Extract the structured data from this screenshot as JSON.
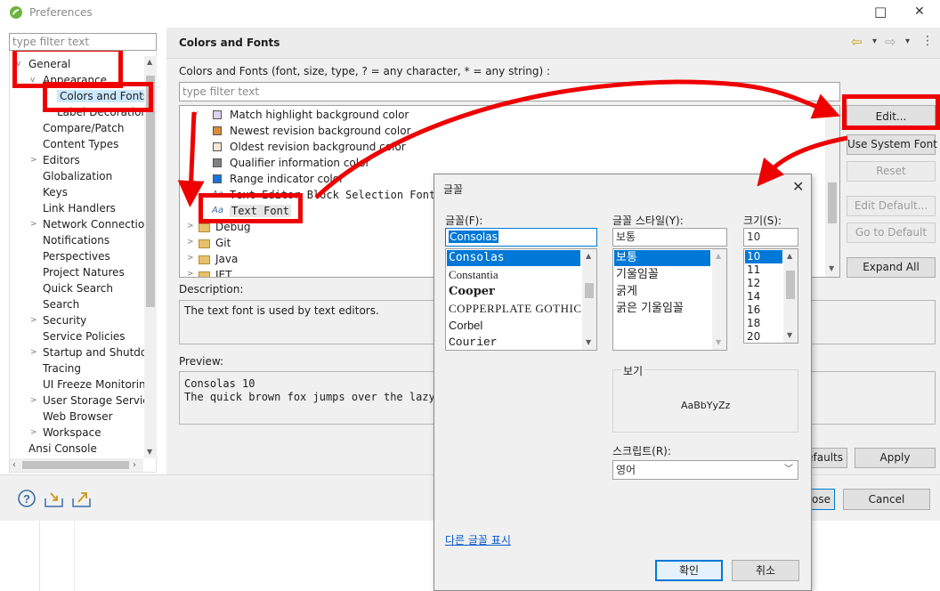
{
  "window": {
    "title": "Preferences",
    "controls": [
      "□",
      "✕"
    ]
  },
  "filter": {
    "placeholder": "type filter text"
  },
  "tree": {
    "items": [
      {
        "label": "General",
        "twisty": "v"
      },
      {
        "label": "Appearance",
        "twisty": "v"
      },
      {
        "label": "Colors and Fonts",
        "twisty": ""
      },
      {
        "label": "Label Decorations",
        "twisty": ""
      },
      {
        "label": "Compare/Patch",
        "twisty": ""
      },
      {
        "label": "Content Types",
        "twisty": ""
      },
      {
        "label": "Editors",
        "twisty": ">"
      },
      {
        "label": "Globalization",
        "twisty": ""
      },
      {
        "label": "Keys",
        "twisty": ""
      },
      {
        "label": "Link Handlers",
        "twisty": ""
      },
      {
        "label": "Network Connection",
        "twisty": ">"
      },
      {
        "label": "Notifications",
        "twisty": ""
      },
      {
        "label": "Perspectives",
        "twisty": ""
      },
      {
        "label": "Project Natures",
        "twisty": ""
      },
      {
        "label": "Quick Search",
        "twisty": ""
      },
      {
        "label": "Search",
        "twisty": ""
      },
      {
        "label": "Security",
        "twisty": ">"
      },
      {
        "label": "Service Policies",
        "twisty": ""
      },
      {
        "label": "Startup and Shutdow",
        "twisty": ">"
      },
      {
        "label": "Tracing",
        "twisty": ""
      },
      {
        "label": "UI Freeze Monitoring",
        "twisty": ""
      },
      {
        "label": "User Storage Service",
        "twisty": ">"
      },
      {
        "label": "Web Browser",
        "twisty": ""
      },
      {
        "label": "Workspace",
        "twisty": ">"
      },
      {
        "label": "Ansi Console",
        "twisty": ""
      }
    ]
  },
  "page": {
    "title": "Colors and Fonts",
    "subtitle": "Colors and Fonts (font, size, type, ? = any character, * = any string) :",
    "filter_placeholder": "type filter text",
    "nav_arrows": [
      "⇦",
      "▾",
      "⇨",
      "▾",
      "⋮"
    ],
    "list": [
      {
        "label": "Match highlight background color",
        "kind": "color",
        "color": "#d9d2f0"
      },
      {
        "label": "Newest revision background color",
        "kind": "color",
        "color": "#d98b3a"
      },
      {
        "label": "Oldest revision background color",
        "kind": "color",
        "color": "#f3e6d3"
      },
      {
        "label": "Qualifier information color",
        "kind": "color",
        "color": "#808080"
      },
      {
        "label": "Range indicator color",
        "kind": "color",
        "color": "#1a73d9"
      },
      {
        "label": "Text Editor Block Selection Font",
        "kind": "font"
      },
      {
        "label": "Text Font",
        "kind": "font"
      },
      {
        "label": "Debug",
        "kind": "group"
      },
      {
        "label": "Git",
        "kind": "group"
      },
      {
        "label": "Java",
        "kind": "group"
      },
      {
        "label": "JET",
        "kind": "group"
      }
    ],
    "buttons": {
      "edit": "Edit...",
      "use_system_font": "Use System Font",
      "reset": "Reset",
      "edit_default": "Edit Default...",
      "go_to_default": "Go to Default",
      "expand_all": "Expand All",
      "restore_defaults": "efaults",
      "apply": "Apply",
      "apply_close": "lose",
      "cancel": "Cancel"
    },
    "description_label": "Description:",
    "description_text": "The text font is used by text editors.",
    "preview_label": "Preview:",
    "preview_line1": "Consolas 10",
    "preview_line2": "The quick brown fox jumps over the lazy"
  },
  "font_dialog": {
    "title": "글꼴",
    "font_label": "글꼴(F):",
    "font_value": "Consolas",
    "fonts": [
      "Consolas",
      "Constantia",
      "Cooper",
      "COPPERPLATE GOTHIC",
      "Corbel",
      "Courier"
    ],
    "style_label": "글꼴 스타일(Y):",
    "style_value": "보통",
    "styles": [
      "보통",
      "기울임꼴",
      "굵게",
      "굵은 기울임꼴"
    ],
    "size_label": "크기(S):",
    "size_value": "10",
    "sizes": [
      "10",
      "11",
      "12",
      "14",
      "16",
      "18",
      "20"
    ],
    "sample_label": "보기",
    "sample_text": "AaBbYyZz",
    "script_label": "스크립트(R):",
    "script_value": "영어",
    "more_fonts_link": "다른 글꼴 표시",
    "ok": "확인",
    "cancel": "취소"
  },
  "colors": {
    "annotation": "#ee0000",
    "selection": "#0078d7"
  }
}
